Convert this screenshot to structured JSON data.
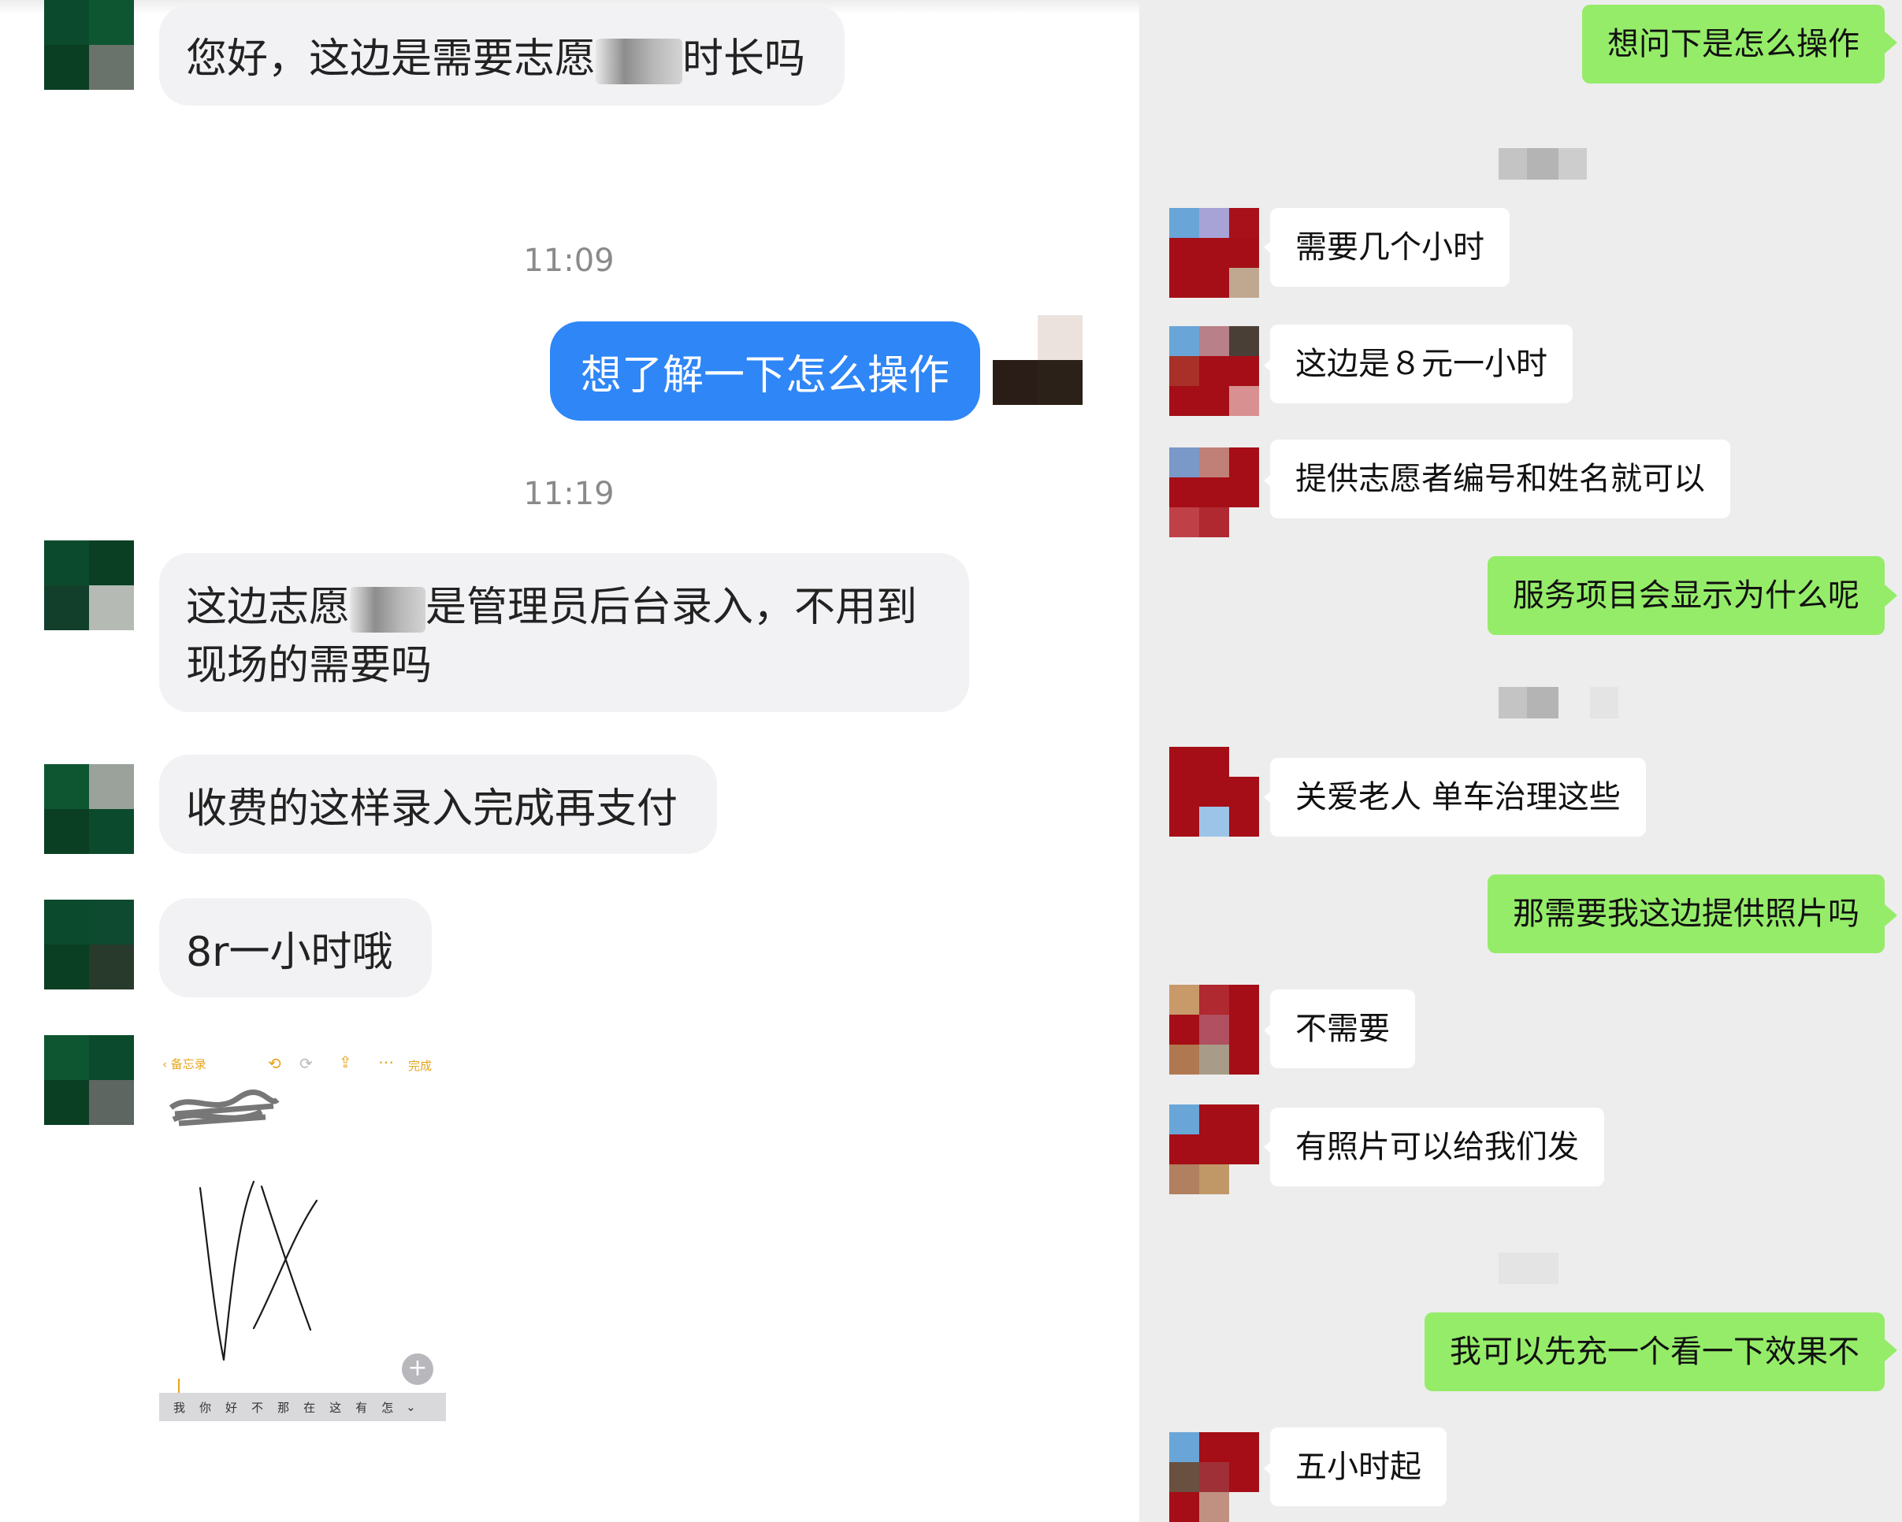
{
  "left_chat": {
    "messages": [
      {
        "kind": "text",
        "side": "incoming",
        "part1": "您好，这边是需要志愿",
        "part2": "时长吗"
      },
      {
        "kind": "timestamp",
        "text": "11:09"
      },
      {
        "kind": "text",
        "side": "outgoing",
        "text": "想了解一下怎么操作"
      },
      {
        "kind": "timestamp",
        "text": "11:19"
      },
      {
        "kind": "text",
        "side": "incoming",
        "part1": "这边志愿",
        "part2": "是管理员后台录入，不用到",
        "line2": "现场的需要吗"
      },
      {
        "kind": "text",
        "side": "incoming",
        "text": "收费的这样录入完成再支付"
      },
      {
        "kind": "text",
        "side": "incoming",
        "text": "8r一小时哦"
      },
      {
        "kind": "image",
        "side": "incoming",
        "notes": {
          "back_label": "备忘录",
          "done_label": "完成",
          "handwriting": "VX",
          "keyboard_candidates": [
            "我",
            "你",
            "好",
            "不",
            "那",
            "在",
            "这",
            "有",
            "怎"
          ]
        }
      }
    ]
  },
  "right_chat": {
    "messages": [
      {
        "side": "outgoing",
        "text": "想问下是怎么操作"
      },
      {
        "side": "incoming",
        "text": "需要几个小时"
      },
      {
        "side": "incoming",
        "text": "这边是８元一小时"
      },
      {
        "side": "incoming",
        "text": "提供志愿者编号和姓名就可以"
      },
      {
        "side": "outgoing",
        "text": "服务项目会显示为什么呢"
      },
      {
        "side": "incoming",
        "text": "关爱老人 单车治理这些"
      },
      {
        "side": "outgoing",
        "text": "那需要我这边提供照片吗"
      },
      {
        "side": "incoming",
        "text": "不需要"
      },
      {
        "side": "incoming",
        "text": "有照片可以给我们发"
      },
      {
        "side": "outgoing",
        "text": "我可以先充一个看一下效果不"
      },
      {
        "side": "incoming",
        "text": "五小时起"
      }
    ]
  },
  "colors": {
    "left_outgoing_bubble": "#2f86f6",
    "left_incoming_bubble": "#f2f2f4",
    "right_outgoing_bubble": "#95ec69",
    "right_incoming_bubble": "#ffffff",
    "right_background": "#ededed"
  }
}
